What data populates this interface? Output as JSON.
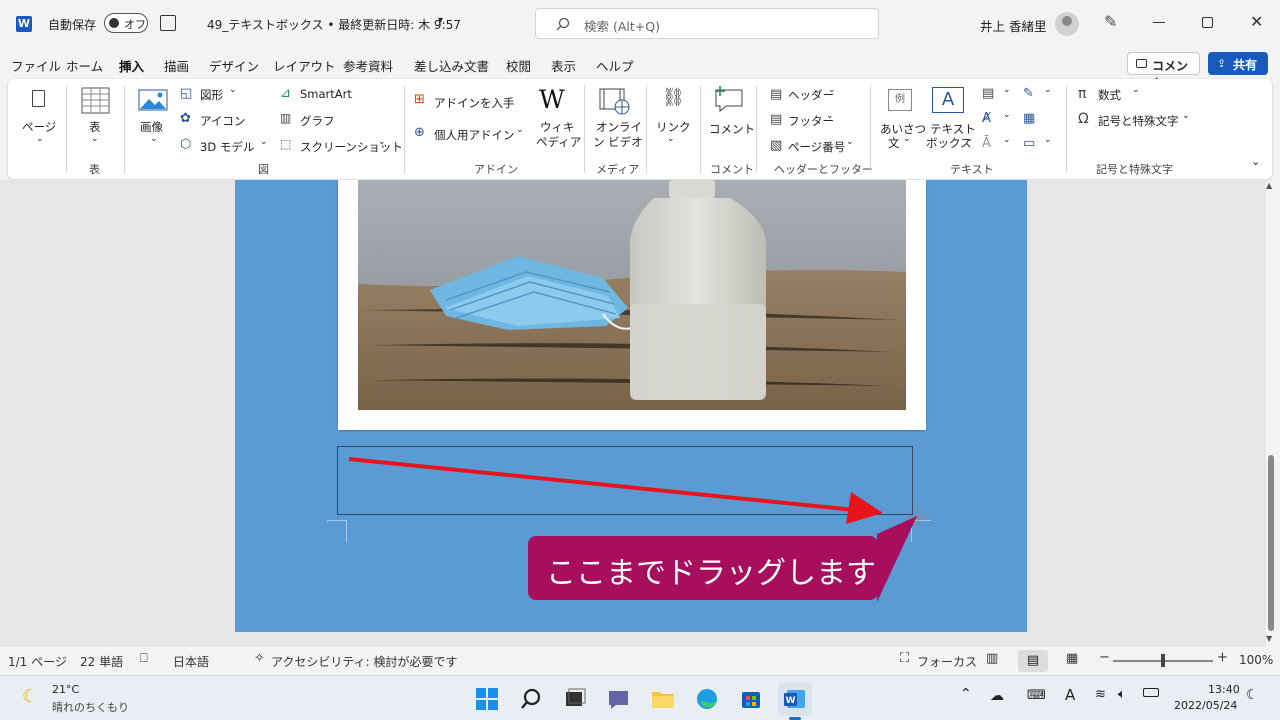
{
  "titlebar": {
    "autosave_label": "自動保存",
    "autosave_toggle": "オフ",
    "doc_title": "49_テキストボックス • 最終更新日時: 木 9:57",
    "search_placeholder": "検索 (Alt+Q)",
    "user_name": "井上 香緒里"
  },
  "menu": {
    "tabs": [
      "ファイル",
      "ホーム",
      "挿入",
      "描画",
      "デザイン",
      "レイアウト",
      "参考資料",
      "差し込み文書",
      "校閲",
      "表示",
      "ヘルプ"
    ],
    "comment_button": "コメント",
    "share_button": "共有"
  },
  "ribbon": {
    "page": "ページ",
    "table": "表",
    "table_group": "表",
    "picture": "画像",
    "shapes": "図形",
    "icons": "アイコン",
    "model3d": "3D モデル",
    "smartart": "SmartArt",
    "graph": "グラフ",
    "screenshot": "スクリーンショット",
    "illust_group": "図",
    "get_addins": "アドインを入手",
    "my_addins": "個人用アドイン",
    "wikipedia": [
      "ウィキ",
      "ペディア"
    ],
    "addin_group": "アドイン",
    "online_video": [
      "オンライ",
      "ン ビデオ"
    ],
    "media_group": "メディア",
    "link": "リンク",
    "comment": "コメント",
    "comment_group": "コメント",
    "header": "ヘッダー",
    "footer": "フッター",
    "page_number": "ページ番号",
    "hf_group": "ヘッダーとフッター",
    "greeting": [
      "あいさつ",
      "文"
    ],
    "textbox": [
      "テキスト",
      "ボックス"
    ],
    "text_group": "テキスト",
    "equation": "数式",
    "symbol": "記号と特殊文字",
    "symbol_group": "記号と特殊文字"
  },
  "document": {
    "callout_text": "ここまでドラッグします"
  },
  "status": {
    "page": "1/1 ページ",
    "words": "22 単語",
    "language": "日本語",
    "accessibility": "アクセシビリティ: 検討が必要です",
    "focus": "フォーカス",
    "zoom": "100%"
  },
  "taskbar": {
    "temp": "21°C",
    "weather": "晴れのちくもり",
    "time": "13:40",
    "date": "2022/05/24"
  }
}
